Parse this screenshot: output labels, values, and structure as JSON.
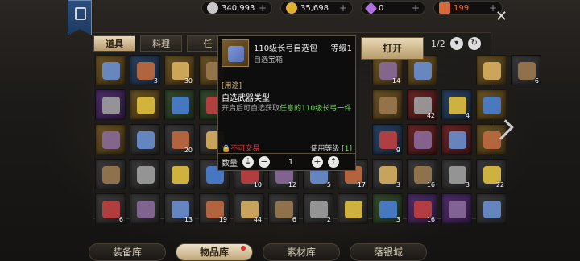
{
  "currency": {
    "silver": "340,993",
    "gold": "35,698",
    "gem": "0",
    "ticket": "199"
  },
  "tabs": [
    "道具",
    "料理",
    "任"
  ],
  "pager": {
    "page": "1/2"
  },
  "tooltip": {
    "name": "110级长弓自选包",
    "level": "等级1",
    "type": "自选宝箱",
    "section": "[用途]",
    "heading": "自选武器类型",
    "desc_pre": "开启后可自选获取",
    "desc_hl": "任意的110级长弓一件",
    "trade": "不可交易",
    "use_label": "使用等级",
    "use_val": "[1]",
    "qty_label": "数量",
    "qty_value": "1"
  },
  "open_button": "打开",
  "bottom_tabs": [
    "装备库",
    "物品库",
    "素材库",
    "落银城"
  ],
  "grid_counts": [
    [
      "",
      "3",
      "30",
      "",
      "",
      "",
      "",
      "",
      "14",
      "",
      "",
      "",
      "6"
    ],
    [
      "",
      "",
      "",
      "",
      "",
      "",
      "",
      "",
      "",
      "42",
      "4",
      "",
      ""
    ],
    [
      "",
      "",
      "20",
      "",
      "",
      "",
      "",
      "",
      "9",
      "",
      "",
      "",
      ""
    ],
    [
      "",
      "",
      "",
      "",
      "10",
      "12",
      "5",
      "17",
      "3",
      "16",
      "3",
      "22",
      ""
    ],
    [
      "6",
      "",
      "13",
      "19",
      "44",
      "6",
      "2",
      "",
      "3",
      "16",
      "",
      "",
      ""
    ]
  ]
}
